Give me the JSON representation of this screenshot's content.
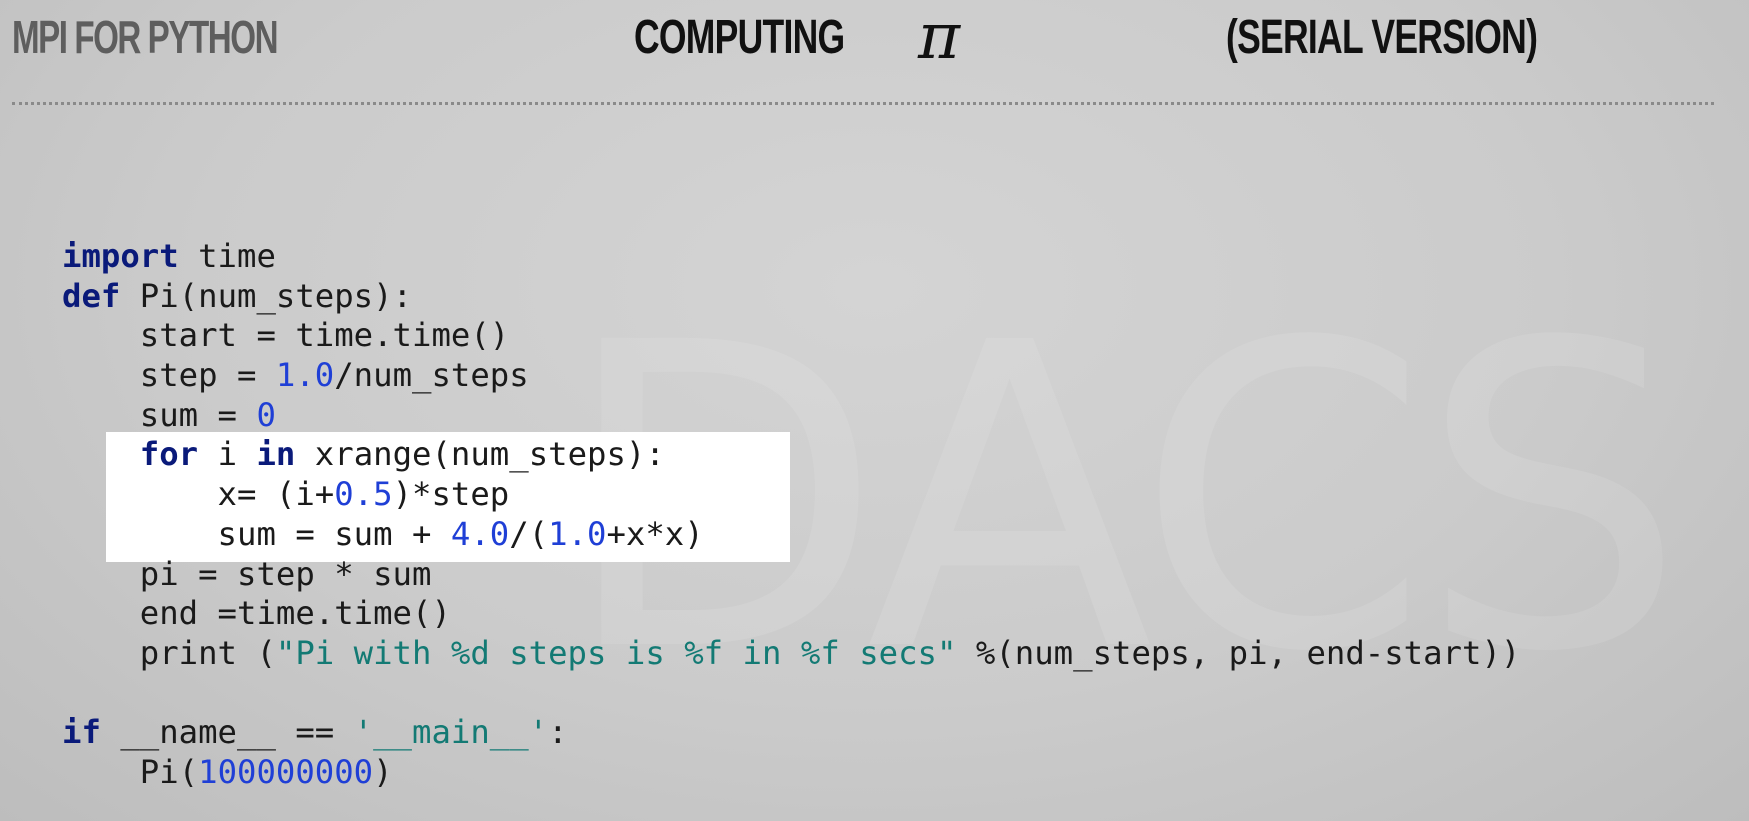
{
  "header": {
    "left_title": "MPI FOR PYTHON",
    "center_title": "COMPUTING",
    "pi_symbol": "π",
    "right_title": "(SERIAL VERSION)"
  },
  "code": {
    "language": "python",
    "lines": [
      "import time",
      "def Pi(num_steps):",
      "    start = time.time()",
      "    step = 1.0/num_steps",
      "    sum = 0",
      "    for i in xrange(num_steps):",
      "        x= (i+0.5)*step",
      "        sum = sum + 4.0/(1.0+x*x)",
      "    pi = step * sum",
      "    end =time.time()",
      "    print (\"Pi with %d steps is %f in %f secs\" %(num_steps, pi, end-start))",
      "",
      "if __name__ == '__main__':",
      "    Pi(100000000)"
    ],
    "highlighted_lines": [
      6,
      7,
      8
    ]
  },
  "colors": {
    "keyword": "#0a1a7a",
    "number": "#1f3fd6",
    "string": "#137a74",
    "highlight_box": "#ffffff",
    "background": "#c9c9c9"
  },
  "watermark": "DACS"
}
